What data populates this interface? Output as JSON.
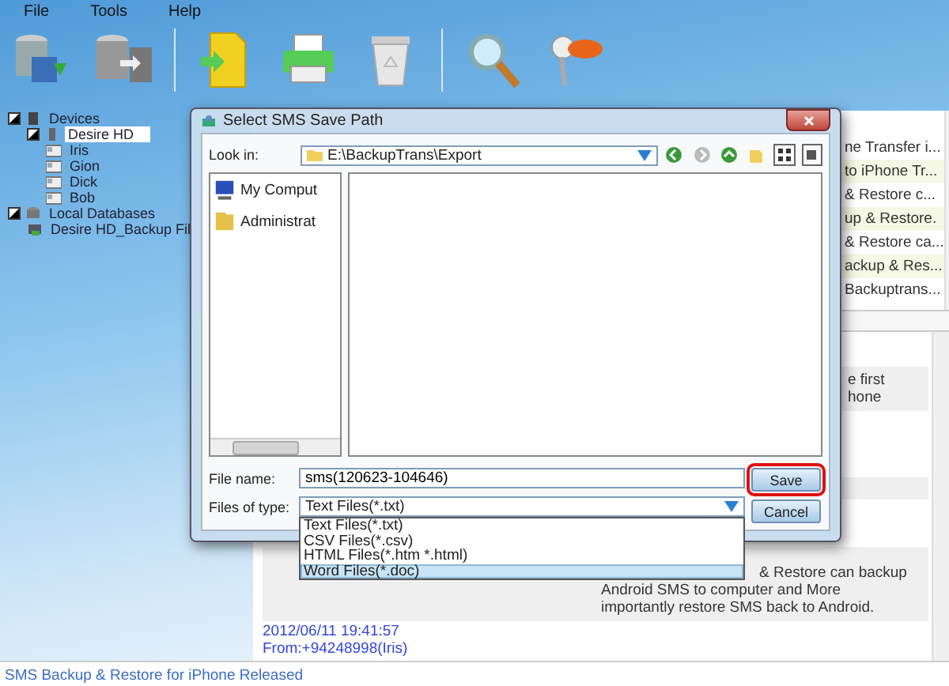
{
  "menu": [
    "File",
    "Tools",
    "Help"
  ],
  "tree": [
    {
      "label": "Devices",
      "kind": "group",
      "expanded": true,
      "selected": false,
      "children": [
        {
          "label": "Desire HD",
          "kind": "phone",
          "expanded": true,
          "selected": true,
          "children": [
            {
              "label": "Iris",
              "kind": "contact",
              "selected": false
            },
            {
              "label": "Gion",
              "kind": "contact",
              "selected": false
            },
            {
              "label": "Dick",
              "kind": "contact",
              "selected": false
            },
            {
              "label": "Bob",
              "kind": "contact",
              "selected": false
            }
          ]
        }
      ]
    },
    {
      "label": "Local Databases",
      "kind": "database",
      "expanded": true,
      "selected": false,
      "children": [
        {
          "label": "Desire HD_Backup Fil",
          "kind": "file",
          "selected": false
        }
      ]
    }
  ],
  "message_list": [
    "ne Transfer i...",
    "to iPhone Tr...",
    "& Restore c...",
    "up & Restore.",
    "& Restore ca...",
    "ackup & Res...",
    "Backuptrans..."
  ],
  "conversation": [
    [
      "e first",
      "hone"
    ],
    [
      "& Restore can backup",
      "Android SMS to computer and More",
      "importantly restore SMS back to Android."
    ]
  ],
  "message_meta": {
    "date": "2012/06/11 19:41:57",
    "from": "From:+94248998(Iris)"
  },
  "status_bar": "SMS Backup & Restore for iPhone Released",
  "dialog": {
    "title": "Select SMS Save Path",
    "look_in_label": "Look in:",
    "look_in_value": "E:\\BackupTrans\\Export",
    "places": [
      {
        "label": "My Comput",
        "kind": "computer"
      },
      {
        "label": "Administrat",
        "kind": "folder"
      }
    ],
    "file_name_label": "File name:",
    "file_name_value": "sms(120623-104646)",
    "file_type_label": "Files of type:",
    "file_type_value": "Text Files(*.txt)",
    "file_type_options": [
      {
        "label": "Text Files(*.txt)",
        "selected": false
      },
      {
        "label": "CSV Files(*.csv)",
        "selected": false
      },
      {
        "label": "HTML Files(*.htm *.html)",
        "selected": false
      },
      {
        "label": "Word Files(*.doc)",
        "selected": true
      }
    ],
    "buttons": [
      {
        "label": "Save",
        "highlighted": true
      },
      {
        "label": "Cancel",
        "highlighted": false
      }
    ]
  }
}
